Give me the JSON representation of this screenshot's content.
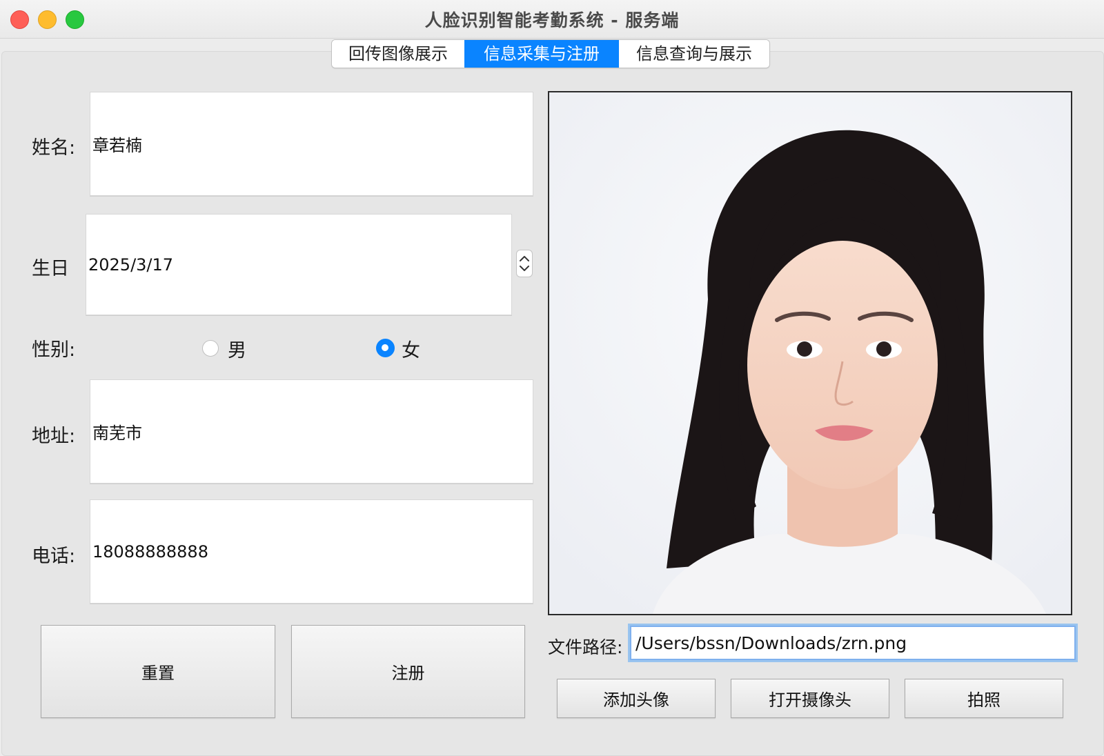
{
  "window": {
    "title": "人脸识别智能考勤系统 - 服务端"
  },
  "tabs": [
    {
      "label": "回传图像展示"
    },
    {
      "label": "信息采集与注册"
    },
    {
      "label": "信息查询与展示"
    }
  ],
  "form": {
    "name_label": "姓名:",
    "name_value": "章若楠",
    "birthday_label": "生日",
    "birthday_value": "2025/3/17",
    "gender_label": "性别:",
    "gender_options": [
      "男",
      "女"
    ],
    "gender_selected": "女",
    "address_label": "地址:",
    "address_value": "南芜市",
    "phone_label": "电话:",
    "phone_value": "18088888888",
    "reset_label": "重置",
    "register_label": "注册"
  },
  "photo_panel": {
    "file_path_label": "文件路径:",
    "file_path_value": "/Users/bssn/Downloads/zrn.png",
    "add_avatar_label": "添加头像",
    "open_camera_label": "打开摄像头",
    "take_photo_label": "拍照"
  },
  "colors": {
    "accent": "#0a84ff",
    "close": "#fe5f57",
    "minimize": "#febc2e",
    "maximize": "#28c840"
  }
}
